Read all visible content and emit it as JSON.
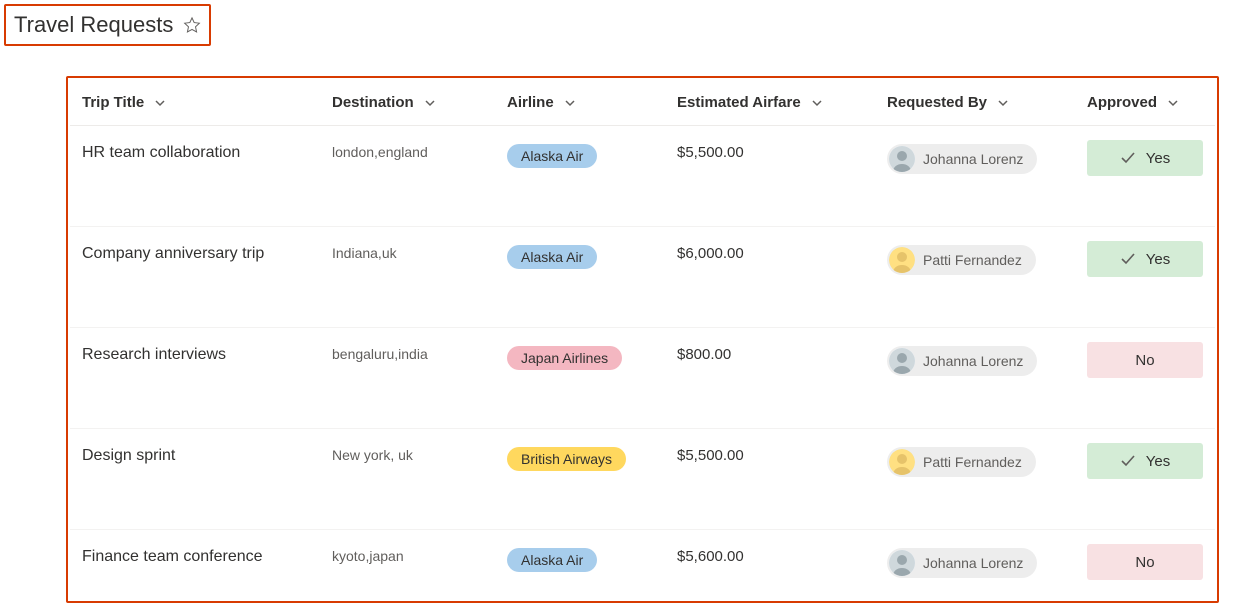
{
  "header": {
    "title": "Travel Requests"
  },
  "table": {
    "columns": {
      "trip_title": "Trip Title",
      "destination": "Destination",
      "airline": "Airline",
      "airfare": "Estimated Airfare",
      "requested_by": "Requested By",
      "approved": "Approved"
    },
    "approved_labels": {
      "yes": "Yes",
      "no": "No"
    },
    "rows": [
      {
        "title": "HR team collaboration",
        "destination": "london,england",
        "airline": "Alaska Air",
        "airline_key": "alaska",
        "airfare": "$5,500.00",
        "requested_by": "Johanna Lorenz",
        "avatar_key": "johanna",
        "approved": "yes"
      },
      {
        "title": "Company anniversary trip",
        "destination": "Indiana,uk",
        "airline": "Alaska Air",
        "airline_key": "alaska",
        "airfare": "$6,000.00",
        "requested_by": "Patti Fernandez",
        "avatar_key": "patti",
        "approved": "yes"
      },
      {
        "title": "Research interviews",
        "destination": "bengaluru,india",
        "airline": "Japan Airlines",
        "airline_key": "japan",
        "airfare": "$800.00",
        "requested_by": "Johanna Lorenz",
        "avatar_key": "johanna",
        "approved": "no"
      },
      {
        "title": "Design sprint",
        "destination": "New york, uk",
        "airline": "British Airways",
        "airline_key": "british",
        "airfare": "$5,500.00",
        "requested_by": "Patti Fernandez",
        "avatar_key": "patti",
        "approved": "yes"
      },
      {
        "title": "Finance team conference",
        "destination": "kyoto,japan",
        "airline": "Alaska Air",
        "airline_key": "alaska",
        "airfare": "$5,600.00",
        "requested_by": "Johanna Lorenz",
        "avatar_key": "johanna",
        "approved": "no"
      }
    ]
  }
}
